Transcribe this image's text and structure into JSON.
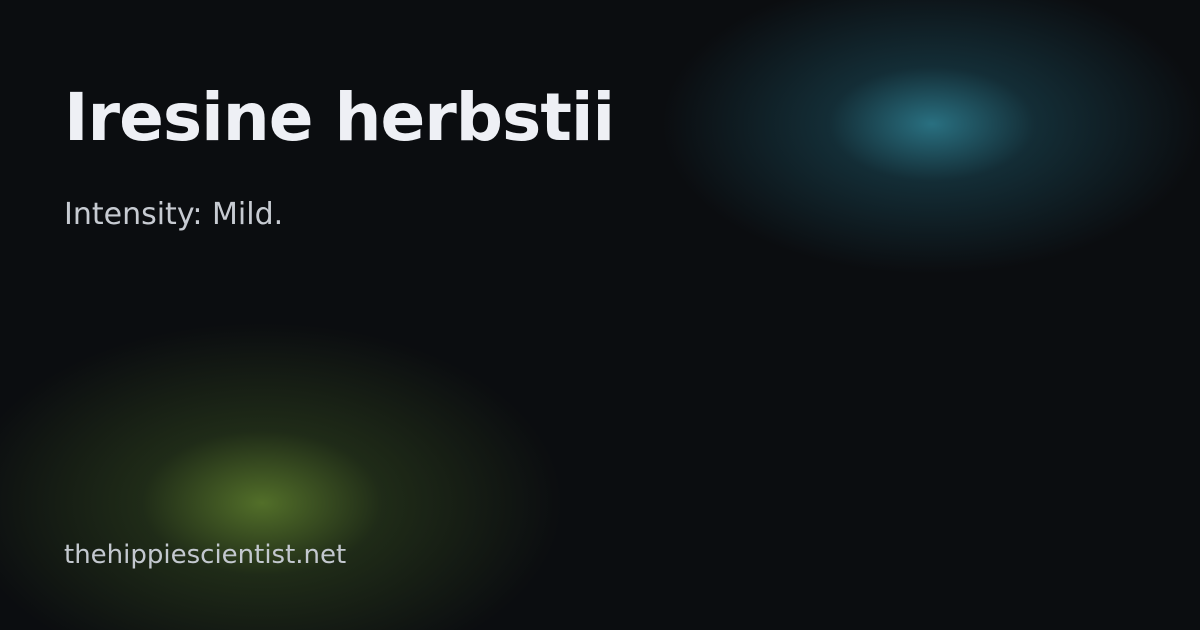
{
  "card": {
    "title": "Iresine herbstii",
    "subtitle": "Intensity: Mild.",
    "site": "thehippiescientist.net"
  },
  "colors": {
    "background": "#0b0d10",
    "glow_teal": "#3596ac",
    "glow_green": "#668a30",
    "title_text": "#eef0f5",
    "body_text": "#c7cbd2"
  }
}
